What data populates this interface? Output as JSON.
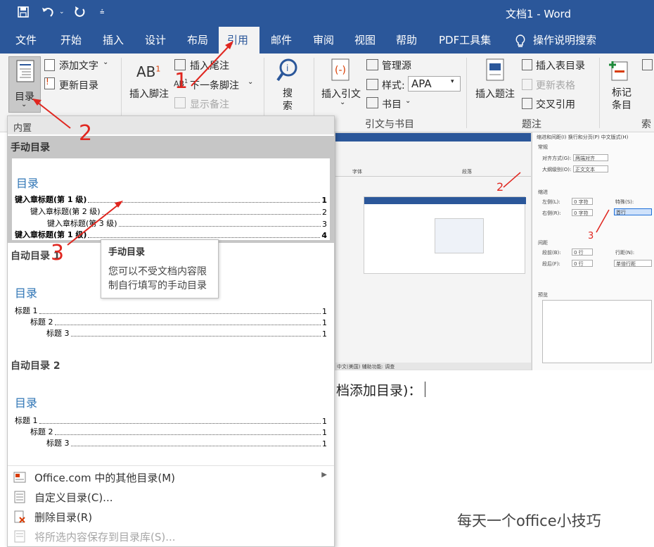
{
  "titlebar": {
    "title": "文档1  -  Word"
  },
  "tabs": [
    "文件",
    "开始",
    "插入",
    "设计",
    "布局",
    "引用",
    "邮件",
    "审阅",
    "视图",
    "帮助",
    "PDF工具集",
    "操作说明搜索"
  ],
  "ribbon": {
    "toc_label": "目录",
    "add_text": "添加文字",
    "update_toc": "更新目录",
    "insert_footnote": "插入脚注",
    "insert_endnote": "插入尾注",
    "next_footnote": "下一条脚注",
    "show_notes": "显示备注",
    "search": "搜\n索",
    "insert_citation": "插入引文",
    "manage_sources": "管理源",
    "style_label": "样式:",
    "style_value": "APA",
    "bibliography": "书目",
    "citations_group": "引文与书目",
    "insert_caption": "插入题注",
    "insert_table_of_figures": "插入表目录",
    "update_table": "更新表格",
    "cross_reference": "交叉引用",
    "captions_group": "题注",
    "mark_entry": "标记\n条目",
    "index_group": "索引"
  },
  "dropdown": {
    "header": "内置",
    "manual": {
      "title": "手动目录",
      "preview_title": "目录",
      "lines": [
        {
          "text": "键入章标题(第 1 级)",
          "page": "1",
          "level": 1
        },
        {
          "text": "键入章标题(第 2 级)",
          "page": "2",
          "level": 2
        },
        {
          "text": "键入章标题(第 3 级)",
          "page": "3",
          "level": 3
        },
        {
          "text": "键入章标题(第 1 级)",
          "page": "4",
          "level": 1
        }
      ]
    },
    "auto1": {
      "title": "自动目录 1",
      "preview_title": "目录",
      "lines": [
        {
          "text": "标题 1",
          "page": "1",
          "level": 1
        },
        {
          "text": "标题 2",
          "page": "1",
          "level": 2
        },
        {
          "text": "标题 3",
          "page": "1",
          "level": 3
        }
      ]
    },
    "auto2": {
      "title": "自动目录 2",
      "preview_title": "目录",
      "lines": [
        {
          "text": "标题 1",
          "page": "1",
          "level": 1
        },
        {
          "text": "标题 2",
          "page": "1",
          "level": 2
        },
        {
          "text": "标题 3",
          "page": "1",
          "level": 3
        }
      ]
    },
    "menu": [
      {
        "label": "Office.com 中的其他目录(M)",
        "icon": "office-icon",
        "arrow": true,
        "dim": false
      },
      {
        "label": "自定义目录(C)...",
        "icon": "custom-toc-icon",
        "arrow": false,
        "dim": false
      },
      {
        "label": "删除目录(R)",
        "icon": "remove-toc-icon",
        "arrow": false,
        "dim": false
      },
      {
        "label": "将所选内容保存到目录库(S)...",
        "icon": "save-toc-icon",
        "arrow": false,
        "dim": true
      }
    ]
  },
  "tooltip": {
    "title": "手动目录",
    "body": "您可以不受文档内容限制自行填写的手动目录"
  },
  "document": {
    "text": "档添加目录)："
  },
  "embedded": {
    "font_label": "字体",
    "para_label": "段落",
    "status": "中文(美国)    辅助功能: 调查",
    "dialog_tabs": "缩进和间距(I)    换行和分页(P)    中文版式(H)",
    "general": "常规",
    "align_label": "对齐方式(G):",
    "align_value": "两端对齐",
    "outline_label": "大纲级别(O):",
    "outline_value": "正文文本",
    "indent": "缩进",
    "left_label": "左侧(L):",
    "left_value": "0 字符",
    "right_label": "右侧(R):",
    "right_value": "0 字符",
    "special_label": "特殊(S):",
    "special_value": "首行",
    "spacing": "间距",
    "before_label": "段前(B):",
    "before_value": "0 行",
    "after_label": "段后(F):",
    "after_value": "0 行",
    "line_label": "行距(N):",
    "line_value": "单倍行距",
    "preview": "预览"
  },
  "annotations": [
    "1",
    "2",
    "3"
  ],
  "watermark": "每天一个office小技巧",
  "colors": {
    "accent": "#2b579a",
    "annotation": "#e0261f",
    "toc_blue": "#2e74b5"
  }
}
